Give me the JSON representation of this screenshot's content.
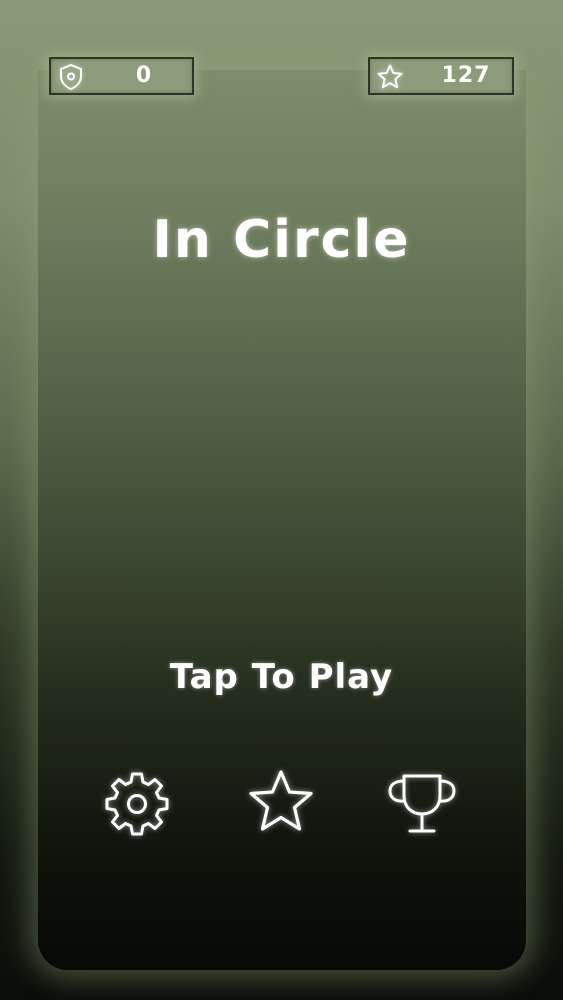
{
  "game": {
    "title": "In Circle",
    "tap_label": "Tap To Play"
  },
  "hud": {
    "shields": {
      "icon": "shield-icon",
      "value": "0"
    },
    "stars": {
      "icon": "star-icon",
      "value": "127"
    }
  },
  "menu": [
    {
      "id": "settings",
      "icon": "gear-icon"
    },
    {
      "id": "rate",
      "icon": "star-icon"
    },
    {
      "id": "leaderboard",
      "icon": "trophy-icon"
    }
  ],
  "colors": {
    "text": "#ffffff",
    "hud_background": "#8c9c7a",
    "hud_border": "#2c3526",
    "background_top": "#8a9a78",
    "background_bottom": "#0a0d08"
  }
}
